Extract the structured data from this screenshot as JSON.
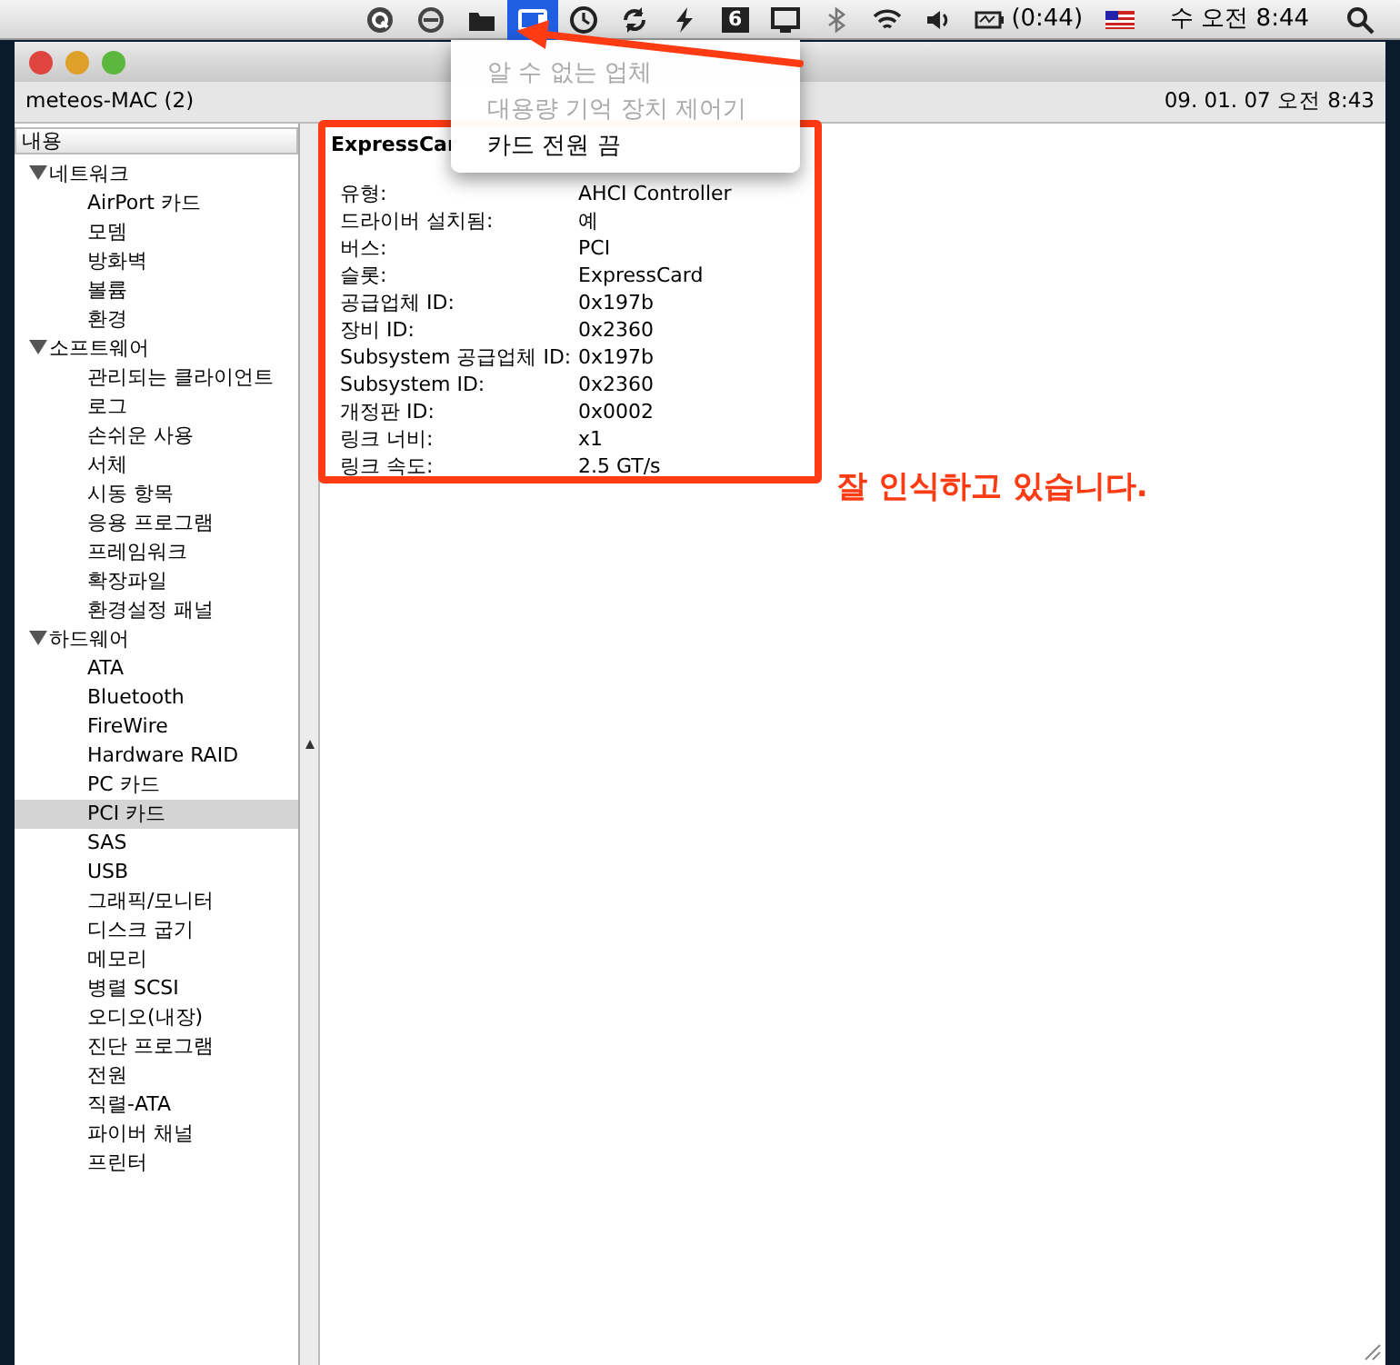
{
  "menubar": {
    "icons": [
      {
        "kind": "q"
      },
      {
        "kind": "minus"
      },
      {
        "kind": "folder"
      },
      {
        "kind": "card",
        "selected": true
      },
      {
        "kind": "clock"
      },
      {
        "kind": "sync"
      },
      {
        "kind": "bolt"
      },
      {
        "kind": "number",
        "label": "6"
      },
      {
        "kind": "display"
      },
      {
        "kind": "bluetooth"
      },
      {
        "kind": "wifi"
      },
      {
        "kind": "volume"
      },
      {
        "kind": "battery",
        "label": "(0:44)"
      },
      {
        "kind": "flag"
      }
    ],
    "clock": "수 오전 8:44"
  },
  "menu": {
    "items": [
      {
        "label": "알 수 없는 업체",
        "disabled": true
      },
      {
        "label": "대용량 기억 장치 제어기",
        "disabled": true
      },
      {
        "label": "카드 전원 끔",
        "disabled": false
      }
    ]
  },
  "window": {
    "computer_name": "meteos-MAC (2)",
    "date": "09. 01. 07 오전 8:43"
  },
  "sidebar": {
    "header": "내용",
    "items": [
      {
        "label": "네트워크",
        "expanded": true,
        "selected": false,
        "children": [
          {
            "label": "AirPort 카드",
            "selected": false
          },
          {
            "label": "모뎀",
            "selected": false
          },
          {
            "label": "방화벽",
            "selected": false
          },
          {
            "label": "볼륨",
            "selected": false
          },
          {
            "label": "환경",
            "selected": false
          }
        ]
      },
      {
        "label": "소프트웨어",
        "expanded": true,
        "selected": false,
        "children": [
          {
            "label": "관리되는 클라이언트",
            "selected": false
          },
          {
            "label": "로그",
            "selected": false
          },
          {
            "label": "손쉬운 사용",
            "selected": false
          },
          {
            "label": "서체",
            "selected": false
          },
          {
            "label": "시동 항목",
            "selected": false
          },
          {
            "label": "응용 프로그램",
            "selected": false
          },
          {
            "label": "프레임워크",
            "selected": false
          },
          {
            "label": "확장파일",
            "selected": false
          },
          {
            "label": "환경설정 패널",
            "selected": false
          }
        ]
      },
      {
        "label": "하드웨어",
        "expanded": true,
        "selected": false,
        "children": [
          {
            "label": "ATA",
            "selected": false
          },
          {
            "label": "Bluetooth",
            "selected": false
          },
          {
            "label": "FireWire",
            "selected": false
          },
          {
            "label": "Hardware RAID",
            "selected": false
          },
          {
            "label": "PC 카드",
            "selected": false
          },
          {
            "label": "PCI 카드",
            "selected": true
          },
          {
            "label": "SAS",
            "selected": false
          },
          {
            "label": "USB",
            "selected": false
          },
          {
            "label": "그래픽/모니터",
            "selected": false
          },
          {
            "label": "디스크 굽기",
            "selected": false
          },
          {
            "label": "메모리",
            "selected": false
          },
          {
            "label": "병렬 SCSI",
            "selected": false
          },
          {
            "label": "오디오(내장)",
            "selected": false
          },
          {
            "label": "진단 프로그램",
            "selected": false
          },
          {
            "label": "전원",
            "selected": false
          },
          {
            "label": "직렬-ATA",
            "selected": false
          },
          {
            "label": "파이버 채널",
            "selected": false
          },
          {
            "label": "프린터",
            "selected": false
          }
        ]
      }
    ]
  },
  "content": {
    "title": "ExpressCar",
    "properties": [
      {
        "label": "유형:",
        "value": "AHCI Controller"
      },
      {
        "label": "드라이버 설치됨:",
        "value": "예"
      },
      {
        "label": "버스:",
        "value": "PCI"
      },
      {
        "label": "슬롯:",
        "value": "ExpressCard"
      },
      {
        "label": "공급업체 ID:",
        "value": "0x197b"
      },
      {
        "label": "장비 ID:",
        "value": "0x2360"
      },
      {
        "label": "Subsystem 공급업체 ID:",
        "value": "0x197b"
      },
      {
        "label": "Subsystem ID:",
        "value": "0x2360"
      },
      {
        "label": "개정판 ID:",
        "value": "0x0002"
      },
      {
        "label": "링크 너비:",
        "value": "x1"
      },
      {
        "label": "링크 속도:",
        "value": "2.5 GT/s"
      }
    ]
  },
  "annotation": {
    "text": "잘 인식하고 있습니다."
  }
}
